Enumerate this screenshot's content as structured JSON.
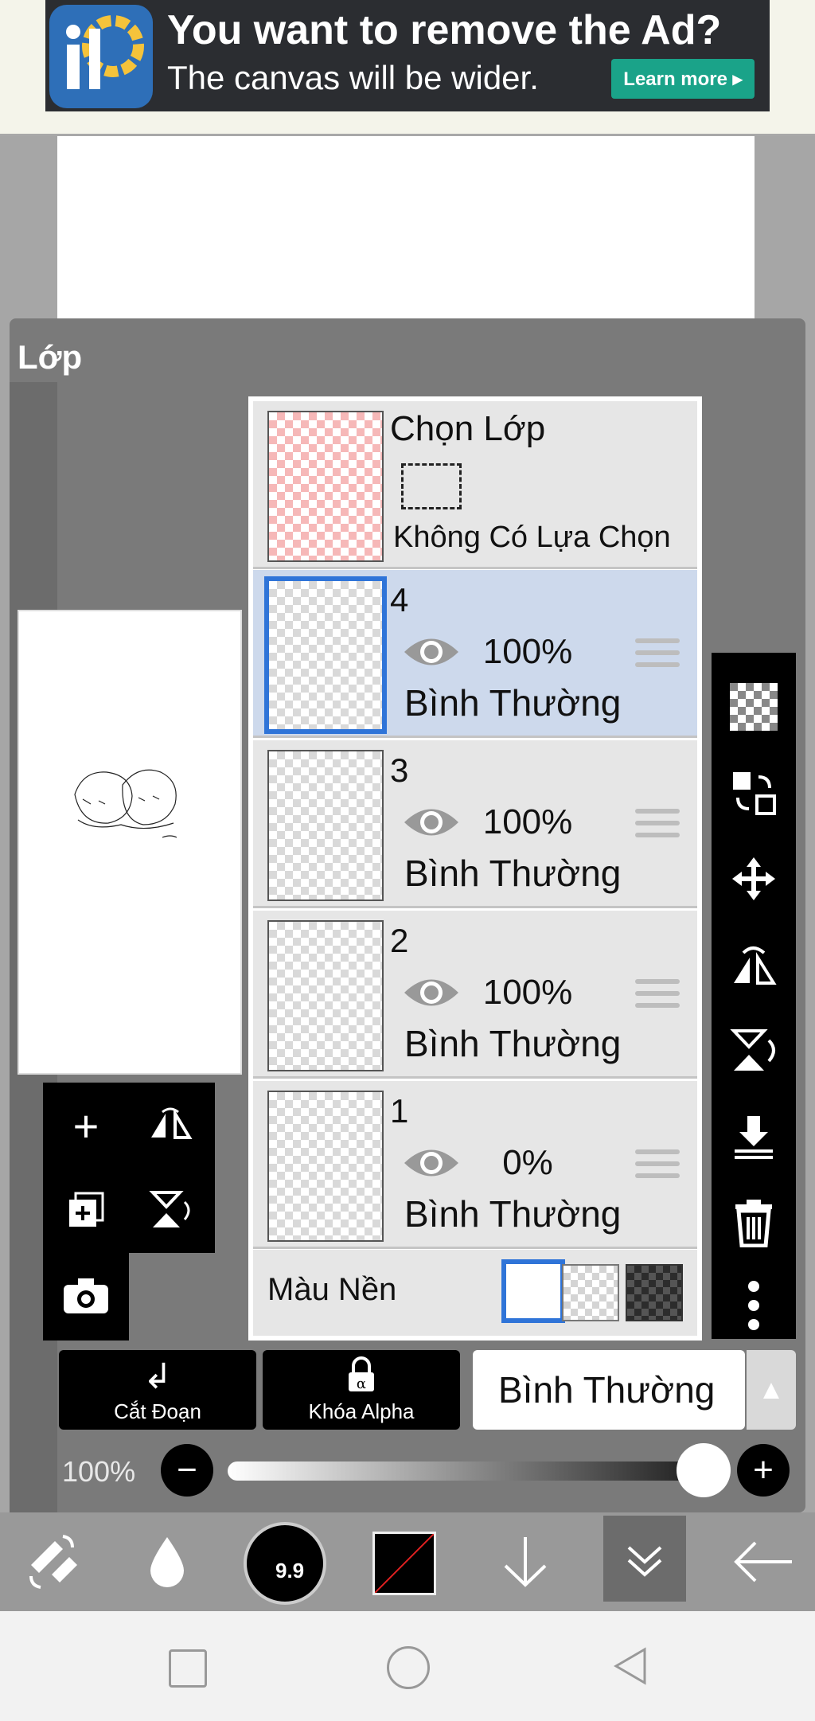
{
  "ad": {
    "title": "You want to remove the Ad?",
    "subtitle": "The canvas will be wider.",
    "learn_more": "Learn more ▸",
    "logo_icon": "ibispaint-logo-icon"
  },
  "panel": {
    "title": "Lớp"
  },
  "selection_layer": {
    "title": "Chọn Lớp",
    "none_label": "Không Có Lựa Chọn"
  },
  "layers": [
    {
      "number": "4",
      "opacity": "100%",
      "mode": "Bình Thường",
      "selected": true
    },
    {
      "number": "3",
      "opacity": "100%",
      "mode": "Bình Thường",
      "selected": false
    },
    {
      "number": "2",
      "opacity": "100%",
      "mode": "Bình Thường",
      "selected": false
    },
    {
      "number": "1",
      "opacity": "0%",
      "mode": "Bình Thường",
      "selected": false
    }
  ],
  "background": {
    "label": "Màu Nền",
    "options": [
      "white",
      "transparent",
      "dark"
    ],
    "selected": "white"
  },
  "actions": {
    "clip_label": "Cắt Đoạn",
    "alpha_lock_label": "Khóa Alpha",
    "blend_mode": "Bình Thường"
  },
  "opacity": {
    "label": "100%",
    "value": 1.0
  },
  "brush": {
    "size_label": "9.9"
  },
  "colors": {
    "accent": "#2f74d8",
    "ad_button": "#1aa389",
    "panel": "#7a7a7a",
    "selected_row": "#cdd9ec"
  }
}
